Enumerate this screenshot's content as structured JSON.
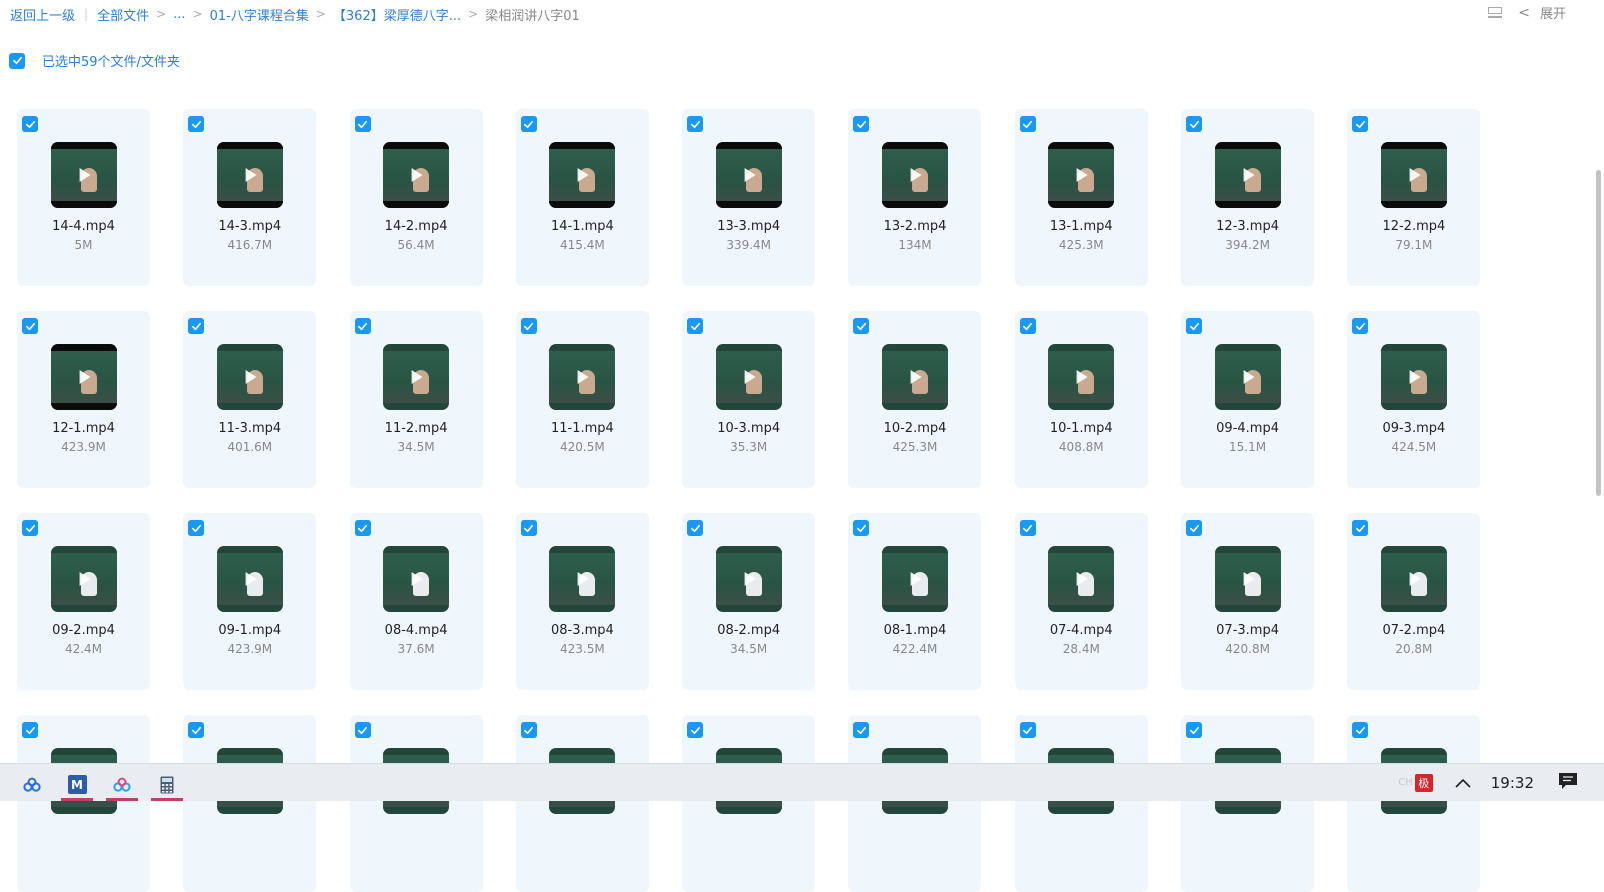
{
  "breadcrumb": {
    "back": "返回上一级",
    "all_files": "全部文件",
    "ellipsis": "...",
    "level1": "01-八字课程合集",
    "level2": "【362】梁厚德八字...",
    "current": "梁相润讲八字01"
  },
  "top_right": {
    "expand_label": "展开"
  },
  "selection": {
    "label": "已选中59个文件/文件夹"
  },
  "files": [
    {
      "name": "14-4.mp4",
      "size": "5M"
    },
    {
      "name": "14-3.mp4",
      "size": "416.7M"
    },
    {
      "name": "14-2.mp4",
      "size": "56.4M"
    },
    {
      "name": "14-1.mp4",
      "size": "415.4M"
    },
    {
      "name": "13-3.mp4",
      "size": "339.4M"
    },
    {
      "name": "13-2.mp4",
      "size": "134M"
    },
    {
      "name": "13-1.mp4",
      "size": "425.3M"
    },
    {
      "name": "12-3.mp4",
      "size": "394.2M"
    },
    {
      "name": "12-2.mp4",
      "size": "79.1M"
    },
    {
      "name": "12-1.mp4",
      "size": "423.9M"
    },
    {
      "name": "11-3.mp4",
      "size": "401.6M"
    },
    {
      "name": "11-2.mp4",
      "size": "34.5M"
    },
    {
      "name": "11-1.mp4",
      "size": "420.5M"
    },
    {
      "name": "10-3.mp4",
      "size": "35.3M"
    },
    {
      "name": "10-2.mp4",
      "size": "425.3M"
    },
    {
      "name": "10-1.mp4",
      "size": "408.8M"
    },
    {
      "name": "09-4.mp4",
      "size": "15.1M"
    },
    {
      "name": "09-3.mp4",
      "size": "424.5M"
    },
    {
      "name": "09-2.mp4",
      "size": "42.4M"
    },
    {
      "name": "09-1.mp4",
      "size": "423.9M"
    },
    {
      "name": "08-4.mp4",
      "size": "37.6M"
    },
    {
      "name": "08-3.mp4",
      "size": "423.5M"
    },
    {
      "name": "08-2.mp4",
      "size": "34.5M"
    },
    {
      "name": "08-1.mp4",
      "size": "422.4M"
    },
    {
      "name": "07-4.mp4",
      "size": "28.4M"
    },
    {
      "name": "07-3.mp4",
      "size": "420.8M"
    },
    {
      "name": "07-2.mp4",
      "size": "20.8M"
    },
    {
      "name": "",
      "size": ""
    },
    {
      "name": "",
      "size": ""
    },
    {
      "name": "",
      "size": ""
    },
    {
      "name": "",
      "size": ""
    },
    {
      "name": "",
      "size": ""
    },
    {
      "name": "",
      "size": ""
    },
    {
      "name": "",
      "size": ""
    },
    {
      "name": "",
      "size": ""
    },
    {
      "name": "",
      "size": ""
    }
  ],
  "taskbar": {
    "apps": [
      "baidu-netdisk-icon",
      "editor-m-icon",
      "baidu-netdisk-icon",
      "calculator-icon"
    ],
    "tray_lang": "CH",
    "ime_label": "极",
    "time": "19:32"
  },
  "colors": {
    "accent": "#1a98f5",
    "link": "#2f7fd8",
    "card_bg": "#f0f7fc",
    "taskbar_underline": "#c4405e"
  }
}
